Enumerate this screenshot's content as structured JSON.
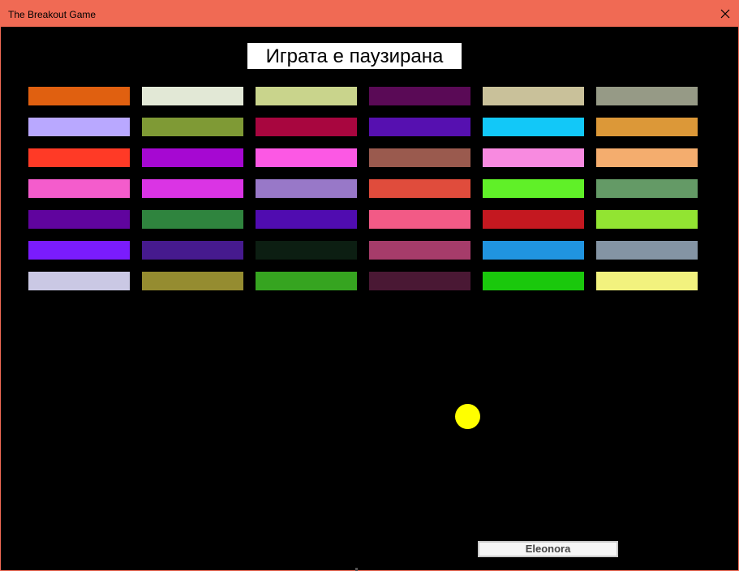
{
  "window": {
    "title": "The Breakout Game",
    "title_bar_color": "#f06a54"
  },
  "game": {
    "pause_message": "Играта е паузирана",
    "paddle_label": "Eleonora",
    "ball_color": "#ffff00",
    "background_color": "#000000"
  },
  "bricks": [
    [
      "#e06010",
      "#e2e8d6",
      "#c9d48c",
      "#5a0a56",
      "#c9c19a",
      "#969a86"
    ],
    [
      "#b9a8ff",
      "#7f9a35",
      "#a8063f",
      "#5610b0",
      "#12c8f8",
      "#dc9838"
    ],
    [
      "#ff3a26",
      "#a608d2",
      "#fc58e4",
      "#9a5a4e",
      "#f88ae0",
      "#f4ad6e"
    ],
    [
      "#f45ccc",
      "#da34e4",
      "#9878c8",
      "#e04c3c",
      "#60f028",
      "#649a66"
    ],
    [
      "#60049e",
      "#2f843e",
      "#500cb0",
      "#f25a86",
      "#c41820",
      "#92e432"
    ],
    [
      "#7a1cfc",
      "#461a8e",
      "#0c1e12",
      "#a63c6a",
      "#2094e0",
      "#8494a4"
    ],
    [
      "#cac8e4",
      "#958c30",
      "#36a420",
      "#4a1834",
      "#1ac80c",
      "#f2f27e"
    ]
  ]
}
